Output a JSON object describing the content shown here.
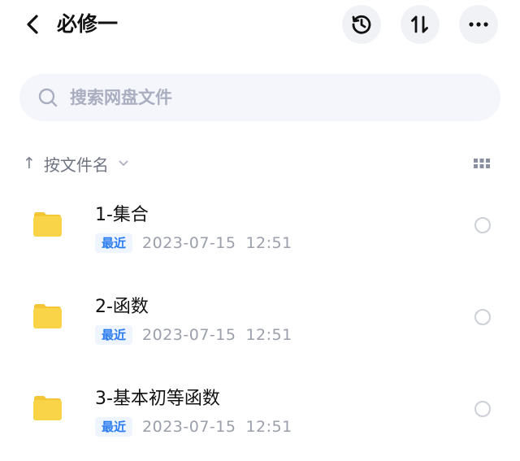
{
  "header": {
    "title": "必修一",
    "icons": {
      "back": "chevron-left-icon",
      "history": "history-icon",
      "sort": "sort-arrows-icon",
      "more": "more-dots-icon"
    }
  },
  "search": {
    "placeholder": "搜索网盘文件",
    "value": "",
    "icon": "search-icon"
  },
  "sort": {
    "arrow": "↑",
    "label": "按文件名",
    "chevron": "chevron-down-icon",
    "view_icon": "grid-view-icon"
  },
  "files": [
    {
      "name": "1-集合",
      "badge": "最近",
      "date": "2023-07-15",
      "time": "12:51",
      "icon": "folder-icon"
    },
    {
      "name": "2-函数",
      "badge": "最近",
      "date": "2023-07-15",
      "time": "12:51",
      "icon": "folder-icon"
    },
    {
      "name": "3-基本初等函数",
      "badge": "最近",
      "date": "2023-07-15",
      "time": "12:51",
      "icon": "folder-icon"
    }
  ],
  "colors": {
    "folder": "#F9D448",
    "folder_tab": "#F4C535",
    "badge_text": "#2A7CF0",
    "badge_bg": "#EEF5FF",
    "search_bg": "#F5F6FB",
    "button_bg": "#F1F2F6"
  }
}
